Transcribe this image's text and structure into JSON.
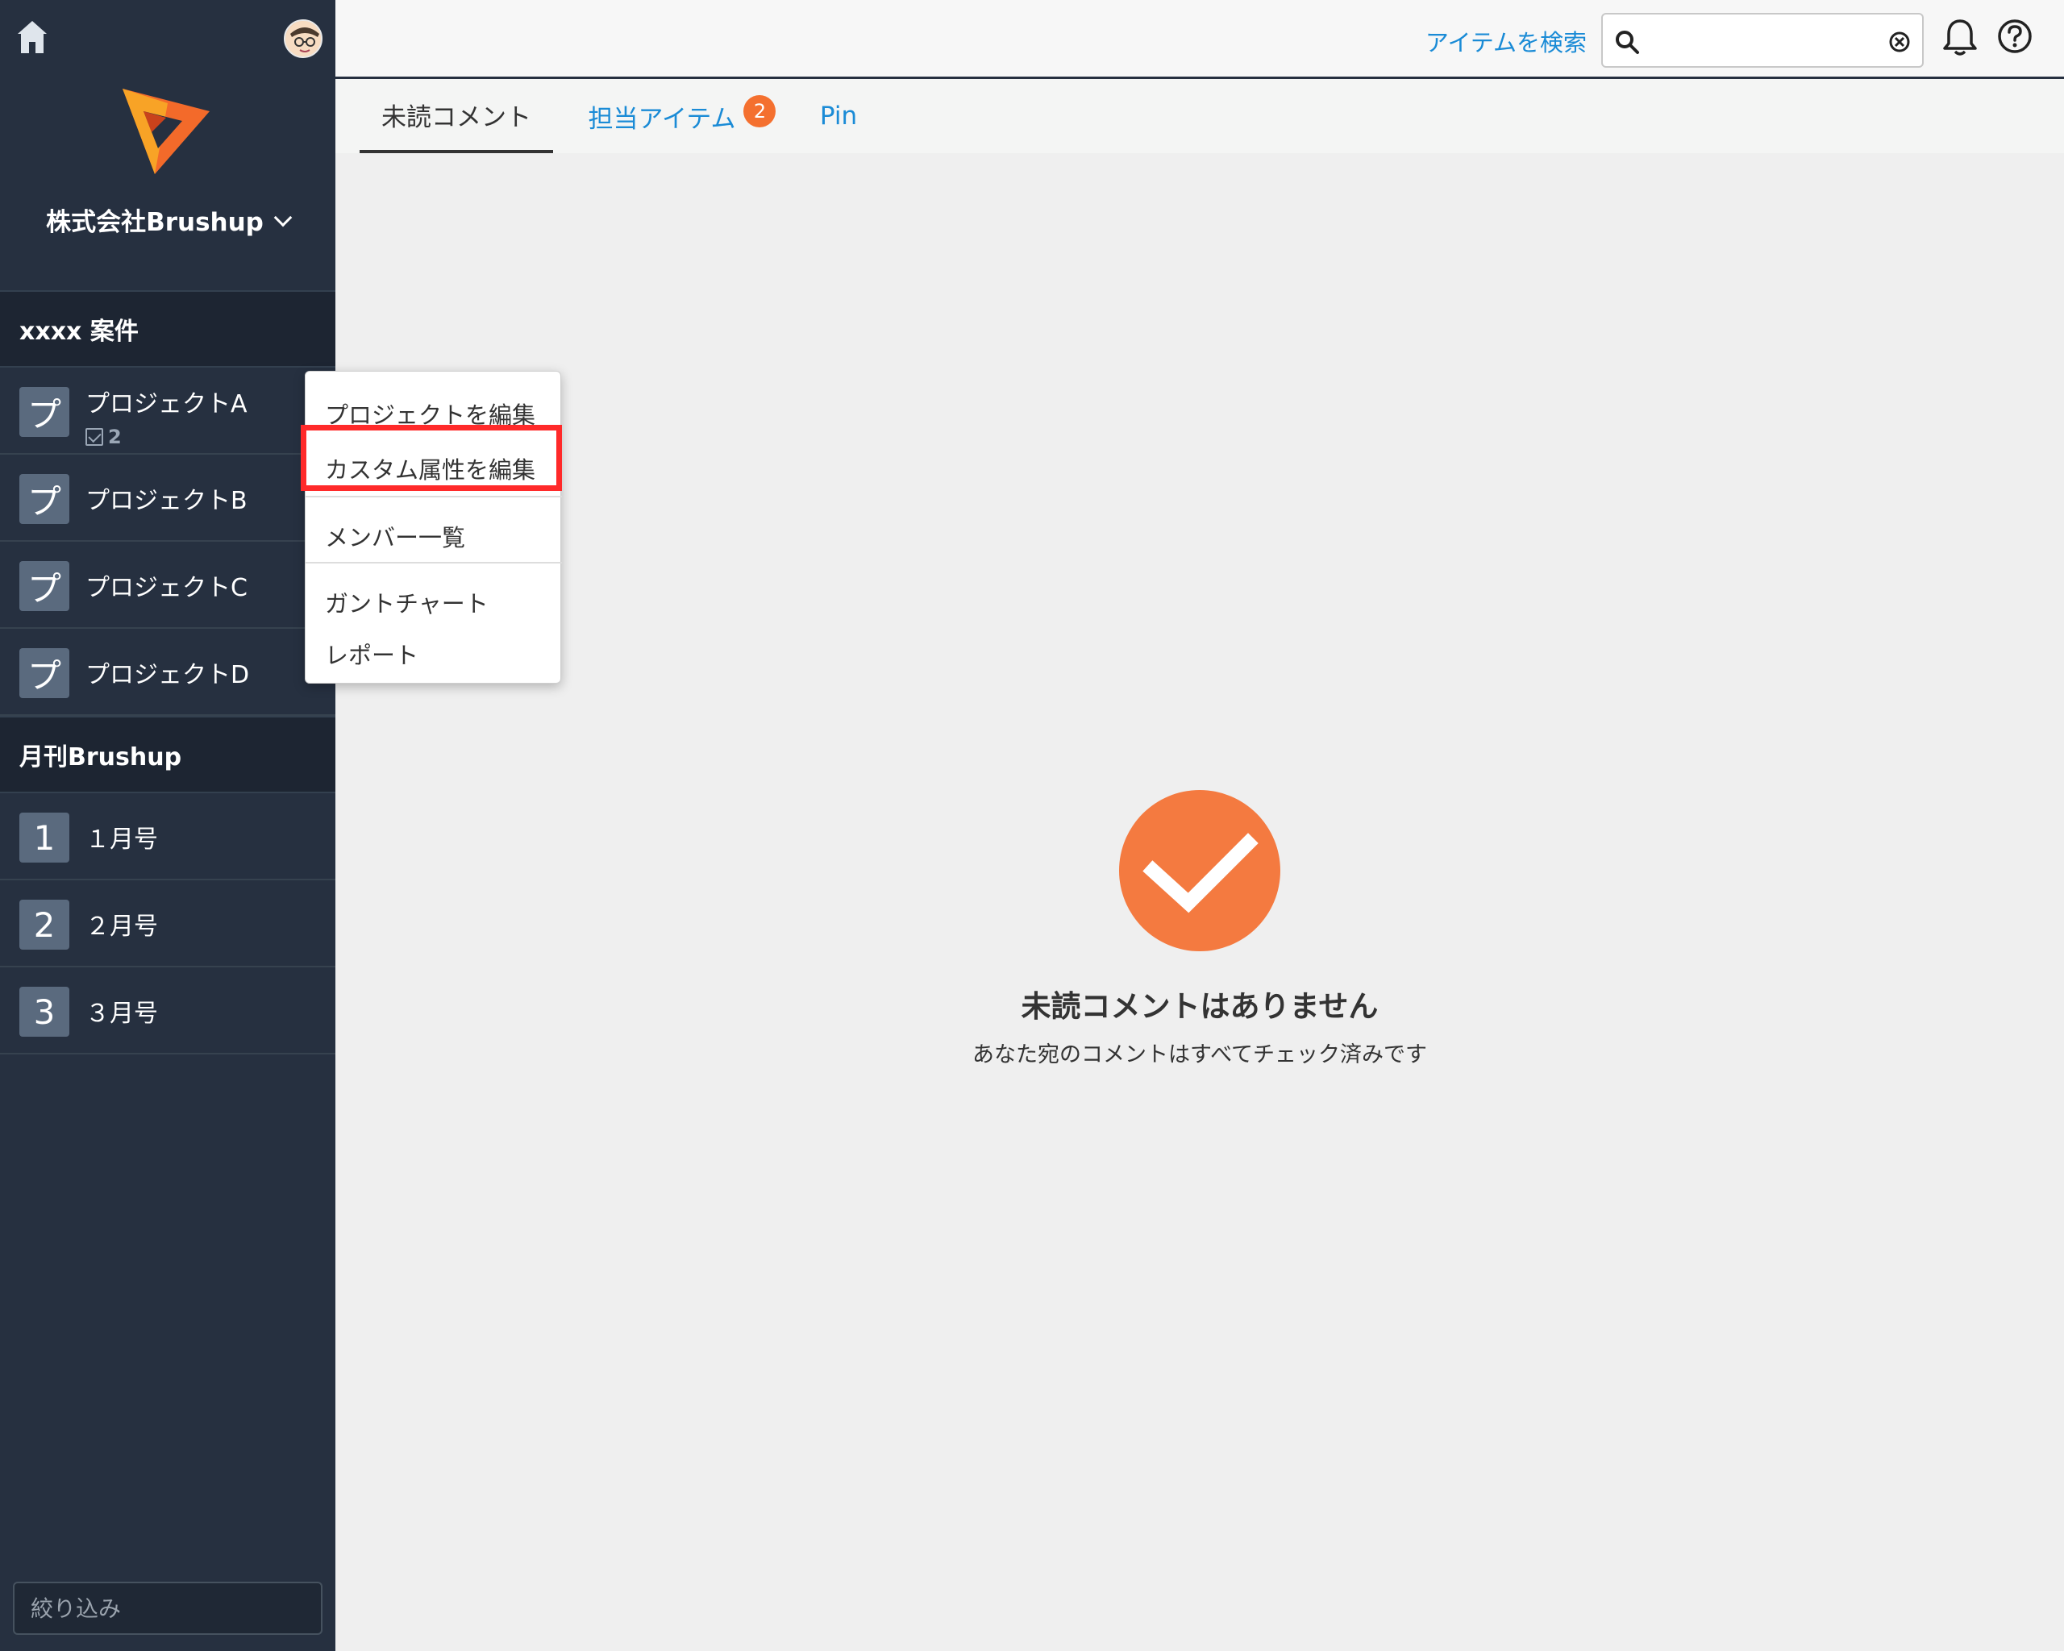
{
  "sidebar": {
    "org_name": "株式会社Brushup",
    "sections": [
      {
        "title": "xxxx 案件",
        "items": [
          {
            "tile": "プ",
            "label": "プロジェクトA",
            "sub_count": "2"
          },
          {
            "tile": "プ",
            "label": "プロジェクトB"
          },
          {
            "tile": "プ",
            "label": "プロジェクトC"
          },
          {
            "tile": "プ",
            "label": "プロジェクトD"
          }
        ]
      },
      {
        "title": "月刊Brushup",
        "items": [
          {
            "tile": "1",
            "label": "１月号"
          },
          {
            "tile": "2",
            "label": "２月号"
          },
          {
            "tile": "3",
            "label": "３月号"
          }
        ]
      }
    ],
    "filter_placeholder": "絞り込み"
  },
  "topbar": {
    "search_link": "アイテムを検索",
    "search_value": ""
  },
  "tabs": [
    {
      "label": "未読コメント",
      "active": true
    },
    {
      "label": "担当アイテム",
      "badge": "2"
    },
    {
      "label": "Pin"
    }
  ],
  "empty_state": {
    "title": "未読コメントはありません",
    "subtitle": "あなた宛のコメントはすべてチェック済みです"
  },
  "context_menu": {
    "items": [
      "プロジェクトを編集",
      "カスタム属性を編集",
      "メンバー一覧",
      "ガントチャート",
      "レポート"
    ],
    "highlighted_index": 1
  },
  "colors": {
    "sidebar_bg": "#263040",
    "section_bg": "#1d2532",
    "accent_orange": "#f4702f",
    "link_blue": "#1a8bd6",
    "highlight_red": "#ff2a2a"
  },
  "icons": [
    "home-icon",
    "avatar",
    "brand-logo",
    "chevron-down-icon",
    "checkbox-icon",
    "search-icon",
    "clear-icon",
    "bell-icon",
    "help-icon",
    "checkmark-icon"
  ]
}
